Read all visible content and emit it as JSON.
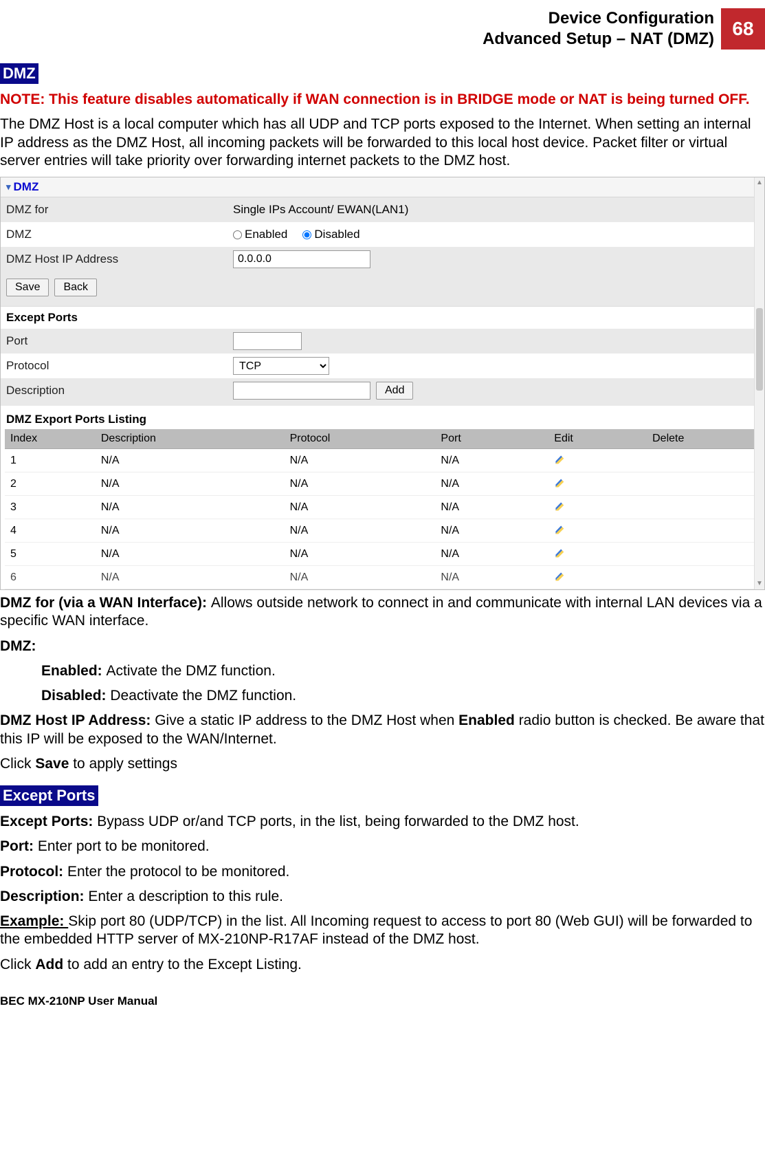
{
  "header": {
    "line1": "Device Configuration",
    "line2": "Advanced Setup – NAT (DMZ)",
    "page_number": "68"
  },
  "sections": {
    "dmz_pill": "DMZ",
    "except_ports_pill": "Except Ports"
  },
  "text": {
    "note": "NOTE: This feature disables automatically if WAN connection is in BRIDGE mode or NAT is being turned OFF.",
    "intro": "The DMZ Host is a local computer which has all UDP and TCP ports exposed to the Internet. When setting an internal IP address as the DMZ Host, all incoming packets will be forwarded to this local host device. Packet filter or virtual server entries will take priority over forwarding internet packets to the DMZ host.",
    "dmz_for_label": "DMZ for (via a WAN Interface): ",
    "dmz_for_text": "Allows outside network to connect in and communicate with internal LAN devices via a specific WAN interface.",
    "dmz_label": "DMZ:",
    "enabled_label": "Enabled: ",
    "enabled_text": "Activate the DMZ function.",
    "disabled_label": "Disabled: ",
    "disabled_text": "Deactivate the DMZ function.",
    "hostip_label": "DMZ Host IP Address: ",
    "hostip_text1": "Give a static IP address to the DMZ Host when ",
    "hostip_bold": "Enabled",
    "hostip_text2": " radio button is checked. Be aware that this IP will be exposed to the WAN/Internet.",
    "click_save1": "Click ",
    "click_save_bold": "Save",
    "click_save2": " to apply settings",
    "except_ports_label": "Except Ports: ",
    "except_ports_text": "Bypass UDP or/and TCP ports, in the list, being forwarded to the DMZ host.",
    "port_label": "Port: ",
    "port_text": "Enter port to be monitored.",
    "protocol_label": "Protocol: ",
    "protocol_text": "Enter the protocol to be monitored.",
    "description_label": "Description: ",
    "description_text": "Enter a description to this rule.",
    "example_label": "Example: ",
    "example_text": "Skip port 80 (UDP/TCP) in the list. All Incoming request to access to port 80 (Web GUI) will be forwarded to the embedded HTTP server of MX-210NP-R17AF instead of the DMZ host.",
    "click_add1": "Click ",
    "click_add_bold": "Add",
    "click_add2": " to add an entry to the Except Listing."
  },
  "panel": {
    "title": "DMZ",
    "rows": {
      "dmz_for": {
        "label": "DMZ for",
        "value": "Single IPs Account/ EWAN(LAN1)"
      },
      "dmz": {
        "label": "DMZ",
        "enabled_label": "Enabled",
        "disabled_label": "Disabled"
      },
      "host_ip": {
        "label": "DMZ Host IP Address",
        "value": "0.0.0.0"
      }
    },
    "buttons": {
      "save": "Save",
      "back": "Back",
      "add": "Add"
    },
    "except_ports_heading": "Except Ports",
    "except_rows": {
      "port": {
        "label": "Port",
        "value": ""
      },
      "protocol": {
        "label": "Protocol",
        "value": "TCP"
      },
      "description": {
        "label": "Description",
        "value": ""
      }
    },
    "listing": {
      "title": "DMZ Export Ports Listing",
      "columns": [
        "Index",
        "Description",
        "Protocol",
        "Port",
        "Edit",
        "Delete"
      ],
      "rows": [
        {
          "index": "1",
          "description": "N/A",
          "protocol": "N/A",
          "port": "N/A"
        },
        {
          "index": "2",
          "description": "N/A",
          "protocol": "N/A",
          "port": "N/A"
        },
        {
          "index": "3",
          "description": "N/A",
          "protocol": "N/A",
          "port": "N/A"
        },
        {
          "index": "4",
          "description": "N/A",
          "protocol": "N/A",
          "port": "N/A"
        },
        {
          "index": "5",
          "description": "N/A",
          "protocol": "N/A",
          "port": "N/A"
        },
        {
          "index": "6",
          "description": "N/A",
          "protocol": "N/A",
          "port": "N/A"
        }
      ]
    }
  },
  "footer": "BEC MX-210NP User Manual"
}
